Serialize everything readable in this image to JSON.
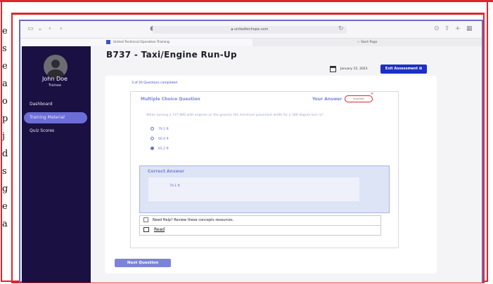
{
  "browser": {
    "url": "unitedtechope.com",
    "tabs": [
      {
        "label": "United Technical Operation Training"
      },
      {
        "label": "Start Page"
      }
    ]
  },
  "sidebar": {
    "user_name": "John Doe",
    "user_role": "Trainee",
    "items": [
      {
        "label": "Dashboard"
      },
      {
        "label": "Training Material"
      },
      {
        "label": "Quiz Scores"
      }
    ]
  },
  "page": {
    "title": "B737 - Taxi/Engine Run-Up",
    "date": "January 15, 2023",
    "exit_label": "Exit Assessment",
    "progress": "3 of 20  Questions completed"
  },
  "question": {
    "heading": "Multiple Choice Question",
    "your_answer_label": "Your Answer",
    "your_answer_value": "Incorrect",
    "text": "When turning a 737-800 with engines on the ground, the minimum pavement width for a 180 degree turn is?",
    "options": [
      {
        "label": "79.1 ft",
        "selected": false
      },
      {
        "label": "60.4 ft",
        "selected": false
      },
      {
        "label": "65.2 ft",
        "selected": true
      }
    ]
  },
  "correct": {
    "heading": "Correct Answer",
    "value": "79.1 ft"
  },
  "help": {
    "text": "Need Help? Review these  concepts resources.",
    "read_label": "Read"
  },
  "next_label": "Next Question",
  "left_strip": [
    "e",
    "s",
    "e",
    "a",
    "",
    "o",
    "p",
    "j",
    "d",
    "s",
    "g",
    "e",
    "a"
  ],
  "colors": {
    "accent": "#1d2fc4",
    "sidebar": "#1a1042",
    "frame": "#e0242b"
  }
}
